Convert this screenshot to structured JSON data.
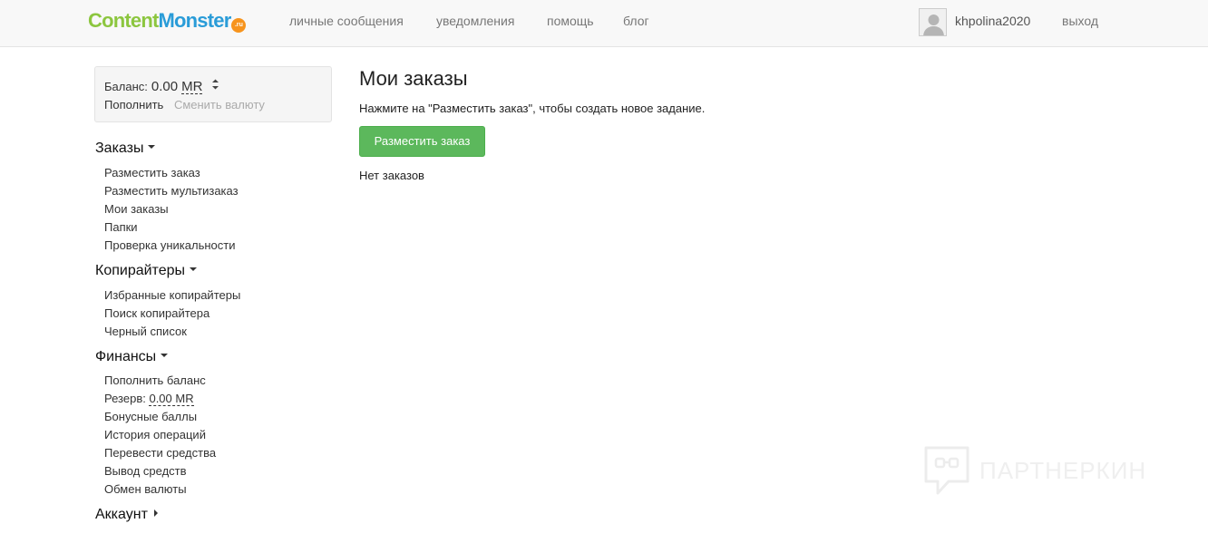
{
  "header": {
    "logo": {
      "part1": "Content",
      "part2": "Monster",
      "badge": ".ru"
    },
    "nav": [
      {
        "label": "личные сообщения"
      },
      {
        "label": "уведомления"
      },
      {
        "label": "помощь"
      },
      {
        "label": "блог"
      }
    ],
    "username": "khpolina2020",
    "logout_label": "выход"
  },
  "balance": {
    "label": "Баланс:",
    "amount": "0.00",
    "currency": "MR",
    "topup_label": "Пополнить",
    "change_currency_label": "Сменить валюту"
  },
  "sidebar": {
    "orders": {
      "heading": "Заказы",
      "items": [
        "Разместить заказ",
        "Разместить мультизаказ",
        "Мои заказы",
        "Папки",
        "Проверка уникальности"
      ]
    },
    "copywriters": {
      "heading": "Копирайтеры",
      "items": [
        "Избранные копирайтеры",
        "Поиск копирайтера",
        "Черный список"
      ]
    },
    "finance": {
      "heading": "Финансы",
      "items": [
        "Пополнить баланс",
        "Резерв:",
        "Бонусные баллы",
        "История операций",
        "Перевести средства",
        "Вывод средств",
        "Обмен валюты"
      ],
      "reserve_value": "0.00 MR"
    },
    "account": {
      "heading": "Аккаунт"
    }
  },
  "main": {
    "title": "Мои заказы",
    "hint": "Нажмите на \"Разместить заказ\", чтобы создать новое задание.",
    "place_order_button": "Разместить заказ",
    "empty_text": "Нет заказов"
  },
  "watermark": {
    "text": "ПАРТНЕРКИН"
  },
  "colors": {
    "logo_green": "#8cc63f",
    "logo_blue": "#2a9cd8",
    "logo_badge": "#f7941d",
    "button_green": "#5cb85c",
    "navbar_bg": "#f8f8f8"
  }
}
